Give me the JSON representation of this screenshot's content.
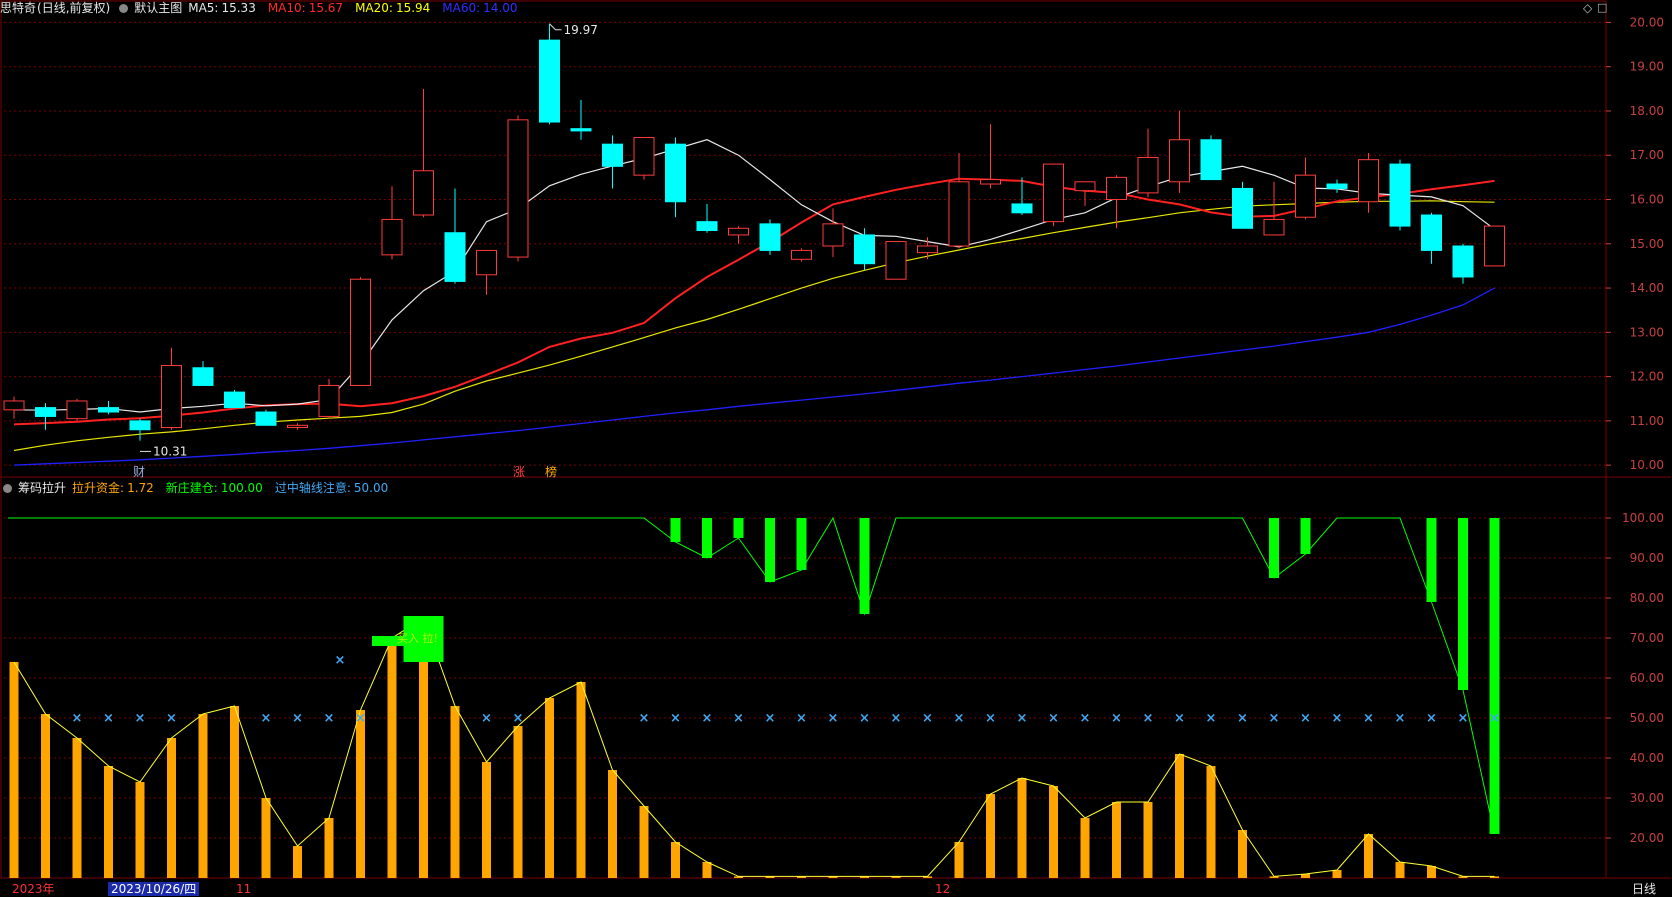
{
  "main_header": {
    "stock_name": "思特奇",
    "period": "(日线,前复权)",
    "template": "默认主图",
    "ma5_label": "MA5:",
    "ma5_value": "15.33",
    "ma10_label": "MA10:",
    "ma10_value": "15.67",
    "ma20_label": "MA20:",
    "ma20_value": "15.94",
    "ma60_label": "MA60:",
    "ma60_value": "14.00"
  },
  "sub_header": {
    "indicator": "筹码拉升",
    "s1_label": "拉升资金:",
    "s1_value": "1.72",
    "s2_label": "新庄建仓:",
    "s2_value": "100.00",
    "s3_label": "过中轴线注意:",
    "s3_value": "50.00"
  },
  "annotations": {
    "high_label": "19.97",
    "low_label": "10.31",
    "event_cai": "财",
    "event_zhang": "涨",
    "event_bang": "榜",
    "buy_label": "买入 拉!"
  },
  "x_axis": {
    "label_year": "2023年",
    "label_cursor_date": "2023/10/26/四",
    "label_11": "11",
    "label_12": "12"
  },
  "period_button": "日线",
  "colors": {
    "up": "#ff3b3b",
    "down": "#00ffff",
    "ma5": "#e8e8e8",
    "ma10": "#ff2020",
    "ma20": "#e6e600",
    "ma60": "#2020ff",
    "grid": "#7a0000",
    "orange_bar": "#ffa500",
    "green_bar": "#00ff00",
    "cross": "#3fa9f5"
  },
  "chart_data": [
    {
      "type": "candlestick",
      "title": "思特奇 (日线,前复权)",
      "ylim": [
        9.8,
        20.1
      ],
      "yticks": [
        10,
        11,
        12,
        13,
        14,
        15,
        16,
        17,
        18,
        19,
        20
      ],
      "ytick_labels": [
        "10.00",
        "11.00",
        "12.00",
        "13.00",
        "14.00",
        "15.00",
        "16.00",
        "17.00",
        "18.00",
        "19.00",
        "20.00"
      ],
      "ohlc": [
        [
          11.25,
          11.55,
          11.05,
          11.45
        ],
        [
          11.3,
          11.4,
          10.8,
          11.1
        ],
        [
          11.05,
          11.5,
          11.0,
          11.45
        ],
        [
          11.3,
          11.45,
          11.15,
          11.2
        ],
        [
          11.0,
          11.05,
          10.55,
          10.8
        ],
        [
          10.85,
          12.65,
          10.8,
          12.25
        ],
        [
          12.2,
          12.35,
          11.8,
          11.8
        ],
        [
          11.65,
          11.7,
          11.3,
          11.3
        ],
        [
          11.2,
          11.25,
          10.9,
          10.9
        ],
        [
          10.85,
          10.95,
          10.8,
          10.9
        ],
        [
          11.1,
          11.95,
          11.05,
          11.8
        ],
        [
          11.8,
          14.25,
          11.8,
          14.2
        ],
        [
          14.75,
          16.3,
          14.65,
          15.55
        ],
        [
          15.65,
          18.5,
          15.6,
          16.65
        ],
        [
          15.25,
          16.25,
          14.1,
          14.15
        ],
        [
          14.3,
          14.8,
          13.85,
          14.85
        ],
        [
          14.7,
          17.9,
          14.6,
          17.8
        ],
        [
          19.6,
          19.97,
          17.7,
          17.75
        ],
        [
          17.6,
          18.25,
          17.35,
          17.55
        ],
        [
          17.25,
          17.45,
          16.25,
          16.75
        ],
        [
          16.55,
          17.4,
          16.45,
          17.4
        ],
        [
          17.25,
          17.4,
          15.6,
          15.95
        ],
        [
          15.5,
          15.9,
          15.25,
          15.3
        ],
        [
          15.2,
          15.4,
          15.0,
          15.35
        ],
        [
          15.45,
          15.55,
          14.75,
          14.85
        ],
        [
          14.65,
          14.9,
          14.6,
          14.85
        ],
        [
          14.95,
          15.8,
          14.7,
          15.45
        ],
        [
          15.2,
          15.35,
          14.4,
          14.55
        ],
        [
          14.2,
          15.05,
          14.2,
          15.05
        ],
        [
          14.8,
          15.15,
          14.65,
          14.95
        ],
        [
          14.95,
          17.05,
          14.9,
          16.4
        ],
        [
          16.35,
          17.7,
          16.25,
          16.45
        ],
        [
          15.9,
          16.5,
          15.65,
          15.7
        ],
        [
          15.5,
          16.8,
          15.4,
          16.8
        ],
        [
          16.2,
          16.4,
          15.85,
          16.4
        ],
        [
          16.0,
          16.55,
          15.35,
          16.5
        ],
        [
          16.15,
          17.6,
          16.05,
          16.95
        ],
        [
          16.4,
          18.0,
          16.15,
          17.35
        ],
        [
          17.35,
          17.45,
          16.45,
          16.45
        ],
        [
          16.25,
          16.4,
          15.35,
          15.35
        ],
        [
          15.2,
          16.4,
          15.2,
          15.55
        ],
        [
          15.6,
          16.95,
          15.55,
          16.55
        ],
        [
          16.35,
          16.45,
          16.15,
          16.25
        ],
        [
          15.95,
          17.05,
          15.7,
          16.9
        ],
        [
          16.8,
          16.9,
          15.3,
          15.4
        ],
        [
          15.65,
          15.7,
          14.55,
          14.85
        ],
        [
          14.95,
          15.0,
          14.1,
          14.25
        ],
        [
          14.5,
          15.4,
          14.5,
          15.4
        ]
      ],
      "ma5": [
        11.25,
        11.24,
        11.26,
        11.28,
        11.2,
        11.28,
        11.33,
        11.4,
        11.34,
        11.38,
        11.48,
        12.28,
        13.28,
        13.94,
        14.38,
        15.5,
        15.79,
        16.31,
        16.57,
        16.76,
        16.93,
        17.14,
        17.35,
        17.0,
        16.45,
        15.88,
        15.5,
        15.19,
        15.17,
        15.05,
        14.93,
        15.1,
        15.32,
        15.55,
        15.7,
        16.04,
        16.29,
        16.51,
        16.63,
        16.75,
        16.55,
        16.26,
        16.24,
        16.14,
        16.1,
        16.06,
        15.86,
        15.33
      ],
      "ma10": [
        10.92,
        10.95,
        10.98,
        11.03,
        11.06,
        11.12,
        11.19,
        11.28,
        11.35,
        11.38,
        11.39,
        11.33,
        11.4,
        11.56,
        11.77,
        12.04,
        12.32,
        12.67,
        12.86,
        12.99,
        13.21,
        13.77,
        14.25,
        14.64,
        15.04,
        15.48,
        15.89,
        16.06,
        16.22,
        16.35,
        16.47,
        16.45,
        16.42,
        16.29,
        16.2,
        16.15,
        16.0,
        15.89,
        15.71,
        15.61,
        15.63,
        15.79,
        15.96,
        16.05,
        16.13,
        16.23,
        16.32,
        16.42
      ],
      "ma20": [
        10.33,
        10.45,
        10.55,
        10.63,
        10.7,
        10.75,
        10.82,
        10.9,
        10.97,
        11.02,
        11.06,
        11.1,
        11.19,
        11.38,
        11.67,
        11.9,
        12.08,
        12.26,
        12.46,
        12.67,
        12.88,
        13.1,
        13.29,
        13.52,
        13.76,
        14.0,
        14.22,
        14.4,
        14.57,
        14.72,
        14.86,
        15.0,
        15.12,
        15.25,
        15.37,
        15.49,
        15.59,
        15.7,
        15.78,
        15.85,
        15.88,
        15.91,
        15.94,
        15.96,
        15.96,
        15.97,
        15.95,
        15.94
      ],
      "ma60": [
        10.0,
        10.03,
        10.06,
        10.09,
        10.12,
        10.16,
        10.2,
        10.24,
        10.29,
        10.33,
        10.38,
        10.44,
        10.5,
        10.57,
        10.64,
        10.71,
        10.78,
        10.86,
        10.94,
        11.02,
        11.1,
        11.18,
        11.25,
        11.33,
        11.4,
        11.47,
        11.54,
        11.61,
        11.69,
        11.77,
        11.85,
        11.92,
        12.0,
        12.08,
        12.16,
        12.24,
        12.33,
        12.42,
        12.51,
        12.6,
        12.69,
        12.79,
        12.89,
        13.0,
        13.18,
        13.39,
        13.62,
        14.0
      ],
      "high_marker": {
        "value": 19.97,
        "index": 17
      },
      "low_marker": {
        "value": 10.31,
        "index": 4
      }
    },
    {
      "type": "bar",
      "title": "筹码拉升",
      "ylim": [
        10,
        106
      ],
      "yticks": [
        20,
        30,
        40,
        50,
        60,
        70,
        80,
        90,
        100
      ],
      "ytick_labels": [
        "20.00",
        "30.00",
        "40.00",
        "50.00",
        "60.00",
        "70.00",
        "80.00",
        "90.00",
        "100.00"
      ],
      "series": [
        {
          "name": "拉升资金",
          "values": [
            64,
            51,
            45,
            38,
            34,
            45,
            51,
            53,
            30,
            18,
            25,
            52,
            70,
            75,
            53,
            39,
            48,
            55,
            59,
            37,
            28,
            19,
            14,
            10,
            8,
            8,
            8,
            8,
            8,
            5,
            19,
            31,
            35,
            33,
            25,
            29,
            29,
            41,
            38,
            22,
            7,
            11,
            12,
            21,
            14,
            13,
            1.7,
            3
          ]
        },
        {
          "name": "新庄建仓",
          "values": [
            100,
            100,
            100,
            100,
            100,
            100,
            100,
            100,
            100,
            100,
            100,
            100,
            100,
            100,
            100,
            100,
            100,
            100,
            100,
            100,
            100,
            94,
            90,
            95,
            84,
            87,
            100,
            76,
            100,
            100,
            100,
            100,
            100,
            100,
            100,
            100,
            100,
            100,
            100,
            100,
            85,
            91,
            100,
            100,
            100,
            79,
            57,
            21,
            100
          ]
        },
        {
          "name": "过中轴线注意",
          "values": [
            50,
            50,
            50,
            50,
            50,
            50,
            50,
            50,
            50,
            50,
            50,
            50,
            50,
            50,
            50,
            50,
            50,
            50,
            50,
            50,
            50,
            50,
            50,
            50,
            50,
            50,
            50,
            50,
            50,
            50,
            50,
            50,
            50,
            50,
            50,
            50,
            50,
            50,
            50,
            50,
            50,
            50,
            50,
            50,
            50,
            50,
            50,
            50
          ]
        }
      ],
      "cross_indices": [
        2,
        3,
        4,
        5,
        8,
        9,
        10,
        11,
        15,
        16,
        20,
        21,
        22,
        23,
        24,
        25,
        26,
        27,
        28,
        29,
        30,
        31,
        32,
        33,
        34,
        35,
        36,
        37,
        38,
        39,
        40,
        41,
        42,
        43,
        44,
        45,
        46,
        47
      ],
      "buy_signal_indices": [
        12,
        13
      ]
    }
  ]
}
